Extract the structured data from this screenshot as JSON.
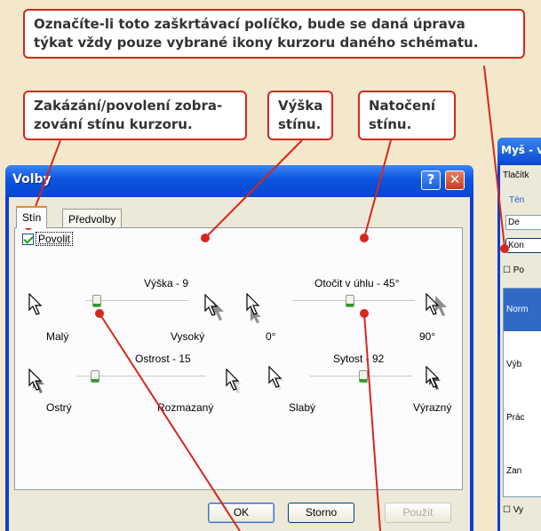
{
  "callouts": {
    "top": [
      "Označíte-li toto zaškrtávací políčko, bude se daná úprava",
      "týkat vždy pouze vybrané ikony kurzoru daného schématu."
    ],
    "shadow_toggle": [
      "Zakázání/povolení zobra-",
      "zování stínu kurzoru."
    ],
    "height": [
      "Výška",
      "stínu."
    ],
    "rotation": [
      "Natočení",
      "stínu."
    ]
  },
  "dialog": {
    "title": "Volby",
    "help_button": "?",
    "close_button": "✕",
    "tabs": [
      "Stín",
      "Předvolby"
    ],
    "enable_checkbox": {
      "label": "Povolit",
      "checked": true
    },
    "sliders": {
      "height": {
        "label": "Výška - 9",
        "min_label": "Malý",
        "max_label": "Vysoký",
        "level": 0.09
      },
      "rotation": {
        "label": "Otočit v úhlu - 45°",
        "min_label": "0°",
        "max_label": "90°",
        "level": 0.5
      },
      "sharpness": {
        "label": "Ostrost - 15",
        "min_label": "Ostrý",
        "max_label": "Rozmazaný",
        "level": 0.15
      },
      "saturation": {
        "label": "Sytost - 92",
        "min_label": "Slabý",
        "max_label": "Výrazný",
        "level": 0.5
      }
    },
    "buttons": {
      "ok": "OK",
      "cancel": "Storno",
      "apply": "Použít"
    }
  },
  "background_dialog": {
    "title": "Myš - v",
    "tab": "Tlačítk",
    "group": "Tén",
    "combo": "De",
    "button": "Kon",
    "checkbox": "Po",
    "list_items": [
      "Norm",
      "Výb",
      "Prác",
      "Zan"
    ],
    "bottom_checkbox": "Vy"
  },
  "colors": {
    "callout_border": "#d8261c",
    "titlebar": "#0c54e0",
    "face": "#ece9d8"
  }
}
